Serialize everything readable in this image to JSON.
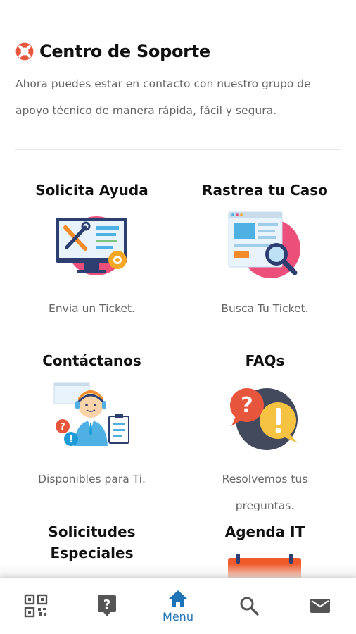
{
  "header": {
    "title": "Centro de Soporte",
    "description": "Ahora puedes estar en contacto con nuestro grupo de apoyo técnico de manera rápida, fácil y segura."
  },
  "cards": [
    {
      "title": "Solicita Ayuda",
      "subtitle": "Envia un Ticket.",
      "icon": "monitor-tools-icon"
    },
    {
      "title": "Rastrea tu Caso",
      "subtitle": "Busca Tu Ticket.",
      "icon": "document-search-icon"
    },
    {
      "title": "Contáctanos",
      "subtitle": "Disponibles para Ti.",
      "icon": "support-agent-icon"
    },
    {
      "title": "FAQs",
      "subtitle": "Resolvemos tus preguntas.",
      "icon": "question-bubbles-icon"
    },
    {
      "title": "Solicitudes Especiales",
      "subtitle": "",
      "icon": "special-request-icon"
    },
    {
      "title": "Agenda IT",
      "subtitle": "",
      "icon": "calendar-icon"
    }
  ],
  "tabbar": {
    "items": [
      {
        "icon": "qr-code-icon",
        "label": ""
      },
      {
        "icon": "question-icon",
        "label": ""
      },
      {
        "icon": "home-icon",
        "label": "Menu",
        "active": true
      },
      {
        "icon": "search-icon",
        "label": ""
      },
      {
        "icon": "mail-icon",
        "label": ""
      }
    ]
  },
  "colors": {
    "accent": "#1f73b7",
    "pink": "#ec4f7a",
    "orange": "#f5a623",
    "navy": "#2d3e70",
    "icon_gray": "#555555"
  }
}
